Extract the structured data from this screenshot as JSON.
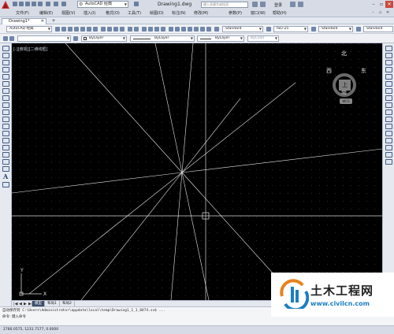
{
  "title_bar": {
    "workspace": "AutoCAD 经典",
    "document_title": "Drawing1.dwg",
    "search_placeholder": "键入关键字或短语",
    "login_label": "登录"
  },
  "menu_bar": {
    "items": [
      "文件(F)",
      "编辑(E)",
      "视图(V)",
      "插入(I)",
      "格式(O)",
      "工具(T)",
      "绘图(D)",
      "标注(N)",
      "修改(M)",
      "参数(P)",
      "窗口(W)",
      "帮助(H)"
    ]
  },
  "doc_tabs": {
    "tabs": [
      {
        "label": "Drawing1*"
      }
    ],
    "add_label": "+"
  },
  "toolbar1": {
    "workspace_value": "AutoCAD 经典",
    "text_style": "Standard",
    "dim_style": "ISO-25",
    "table_style": "Standard",
    "multileader_style": "Standard"
  },
  "toolbar2": {
    "color_value": "ByLayer",
    "linetype_value": "ByLayer",
    "lineweight_value": "ByLayer",
    "plotstyle_value": "ByColor"
  },
  "left_palette": {
    "text_tool": "A"
  },
  "viewport": {
    "label": "[-][俯视][二维线框]"
  },
  "viewcube": {
    "north": "北",
    "south": "南",
    "east": "东",
    "west": "西",
    "face": "上",
    "wcs": "WCS"
  },
  "ucs": {
    "x_label": "X",
    "y_label": "Y"
  },
  "layout_tabs": {
    "nav": [
      "|◀",
      "◀",
      "▶",
      "▶|"
    ],
    "tabs": [
      {
        "label": "模型",
        "active": true
      },
      {
        "label": "布局1",
        "active": false
      },
      {
        "label": "布局2",
        "active": false
      }
    ]
  },
  "command_line": {
    "history": "自动保存到 C:\\Users\\Administrator\\appdata\\local\\temp\\Drawing1_1_1_8474.sv$ ...",
    "prompt": "命令: 键入命令"
  },
  "status_bar": {
    "coordinates": "2780.0575, 1231.7177, 0.0000"
  },
  "watermark": {
    "name": "土木工程网",
    "url": "www.civilcn.com",
    "colors": {
      "blue": "#1c7ec2",
      "orange": "#e8821c"
    }
  },
  "theme": {
    "canvas_bg": "#000000",
    "ui_bg": "#d6dbe6",
    "accent": "#3d4f69"
  }
}
